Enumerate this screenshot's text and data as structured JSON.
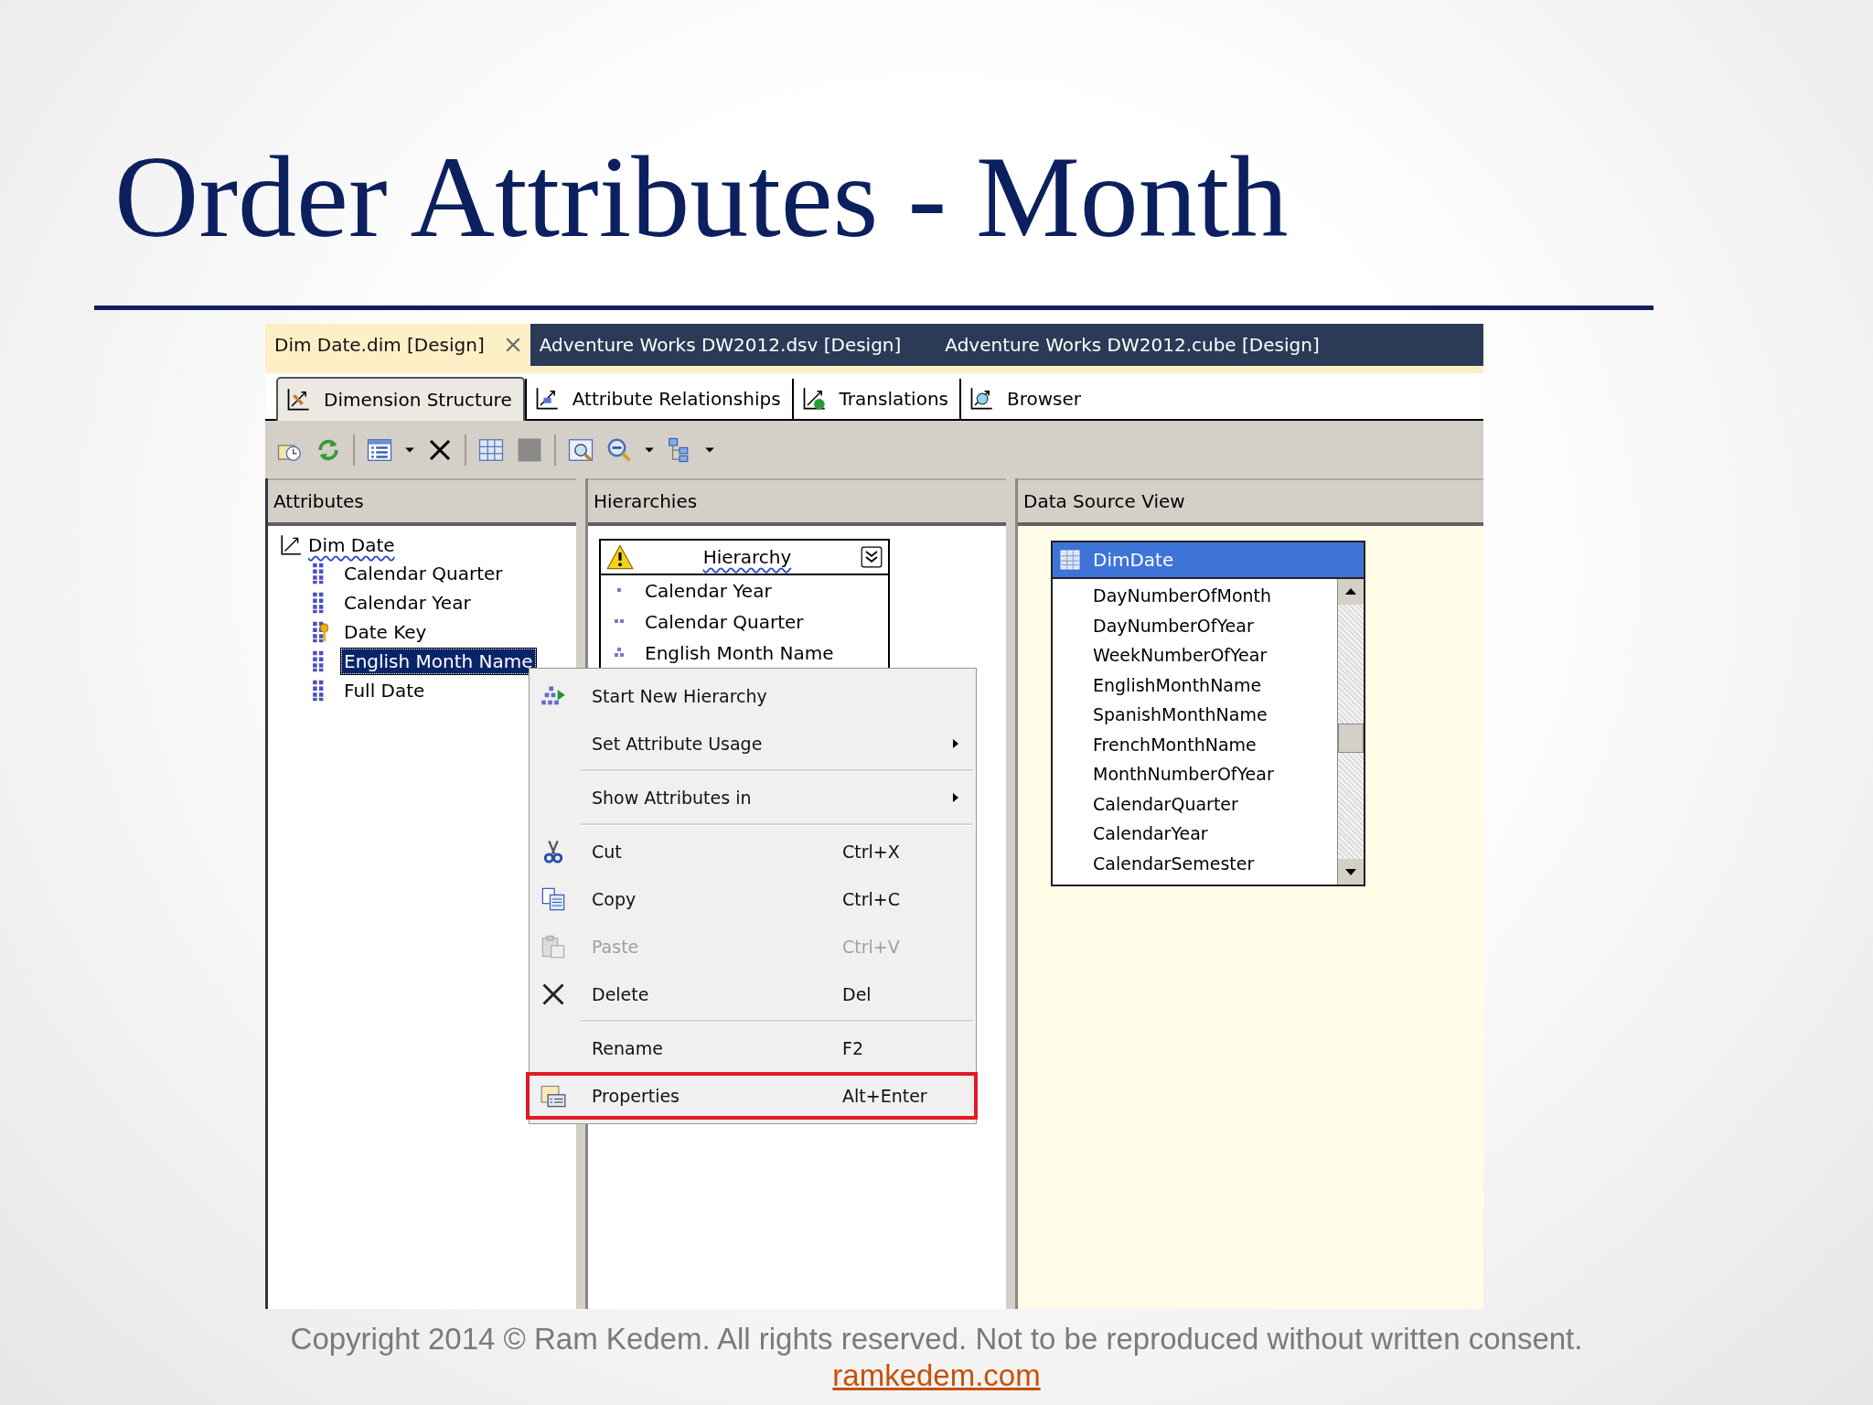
{
  "slide": {
    "title": "Order Attributes - Month",
    "footer": "Copyright 2014 © Ram Kedem. All rights reserved. Not to be reproduced without written consent.",
    "link": "ramkedem.com"
  },
  "document_tabs": [
    {
      "label": "Dim Date.dim [Design]",
      "selected": true
    },
    {
      "label": "Adventure Works DW2012.dsv [Design]",
      "selected": false
    },
    {
      "label": "Adventure Works DW2012.cube [Design]",
      "selected": false
    }
  ],
  "designer_tabs": [
    {
      "label": "Dimension Structure",
      "selected": true
    },
    {
      "label": "Attribute Relationships",
      "selected": false
    },
    {
      "label": "Translations",
      "selected": false
    },
    {
      "label": "Browser",
      "selected": false
    }
  ],
  "attributes": {
    "title": "Attributes",
    "root": "Dim Date",
    "items": [
      {
        "label": "Calendar Quarter",
        "key": false,
        "selected": false
      },
      {
        "label": "Calendar Year",
        "key": false,
        "selected": false
      },
      {
        "label": "Date Key",
        "key": true,
        "selected": false
      },
      {
        "label": "English Month Name",
        "key": false,
        "selected": true
      },
      {
        "label": "Full Date",
        "key": false,
        "selected": false
      }
    ]
  },
  "hierarchies": {
    "title": "Hierarchies",
    "hierarchy": {
      "name": "Hierarchy",
      "levels": [
        "Calendar Year",
        "Calendar Quarter",
        "English Month Name"
      ]
    }
  },
  "data_source_view": {
    "title": "Data Source View",
    "table": {
      "name": "DimDate",
      "columns": [
        "DayNumberOfMonth",
        "DayNumberOfYear",
        "WeekNumberOfYear",
        "EnglishMonthName",
        "SpanishMonthName",
        "FrenchMonthName",
        "MonthNumberOfYear",
        "CalendarQuarter",
        "CalendarYear",
        "CalendarSemester"
      ]
    }
  },
  "context_menu": {
    "items": [
      {
        "kind": "item",
        "label": "Start New Hierarchy",
        "submenu": false,
        "disabled": false,
        "highlighted": false
      },
      {
        "kind": "item",
        "label": "Set Attribute Usage",
        "submenu": true,
        "disabled": false,
        "highlighted": false
      },
      {
        "kind": "separator"
      },
      {
        "kind": "item",
        "label": "Show Attributes in",
        "submenu": true,
        "disabled": false,
        "highlighted": false
      },
      {
        "kind": "separator"
      },
      {
        "kind": "item",
        "label": "Cut",
        "shortcut": "Ctrl+X",
        "submenu": false,
        "disabled": false,
        "highlighted": false
      },
      {
        "kind": "item",
        "label": "Copy",
        "shortcut": "Ctrl+C",
        "submenu": false,
        "disabled": false,
        "highlighted": false
      },
      {
        "kind": "item",
        "label": "Paste",
        "shortcut": "Ctrl+V",
        "submenu": false,
        "disabled": true,
        "highlighted": false
      },
      {
        "kind": "item",
        "label": "Delete",
        "shortcut": "Del",
        "submenu": false,
        "disabled": false,
        "highlighted": false
      },
      {
        "kind": "separator"
      },
      {
        "kind": "item",
        "label": "Rename",
        "shortcut": "F2",
        "submenu": false,
        "disabled": false,
        "highlighted": false
      },
      {
        "kind": "item",
        "label": "Properties",
        "shortcut": "Alt+Enter",
        "submenu": false,
        "disabled": false,
        "highlighted": true
      }
    ]
  }
}
